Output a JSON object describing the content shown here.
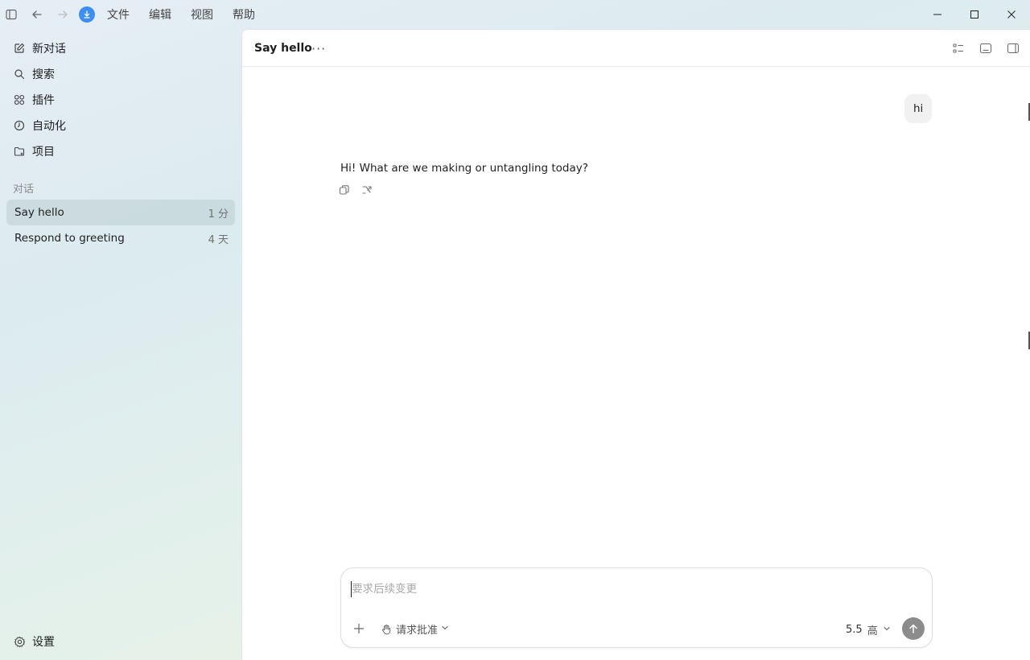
{
  "menu": {
    "items": [
      "文件",
      "编辑",
      "视图",
      "帮助"
    ]
  },
  "sidebar": {
    "nav": [
      {
        "label": "新对话",
        "icon": "compose-icon"
      },
      {
        "label": "搜索",
        "icon": "search-icon"
      },
      {
        "label": "插件",
        "icon": "plugins-grid-icon"
      },
      {
        "label": "自动化",
        "icon": "clock-icon"
      },
      {
        "label": "项目",
        "icon": "folder-plus-icon"
      }
    ],
    "section_label": "对话",
    "conversations": [
      {
        "title": "Say hello",
        "time": "1 分",
        "active": true
      },
      {
        "title": "Respond to greeting",
        "time": "4 天",
        "active": false
      }
    ],
    "settings_label": "设置"
  },
  "main": {
    "title": "Say hello",
    "more": "···",
    "messages": {
      "user": "hi",
      "assistant": "Hi! What are we making or untangling today?"
    }
  },
  "composer": {
    "placeholder": "要求后续变更",
    "value": "",
    "approval_label": "请求批准",
    "model": "5.5",
    "effort": "高"
  },
  "colors": {
    "accent": "#3d8ef0",
    "active_row": "#c9d8db",
    "send_button": "#8c8c8c"
  }
}
